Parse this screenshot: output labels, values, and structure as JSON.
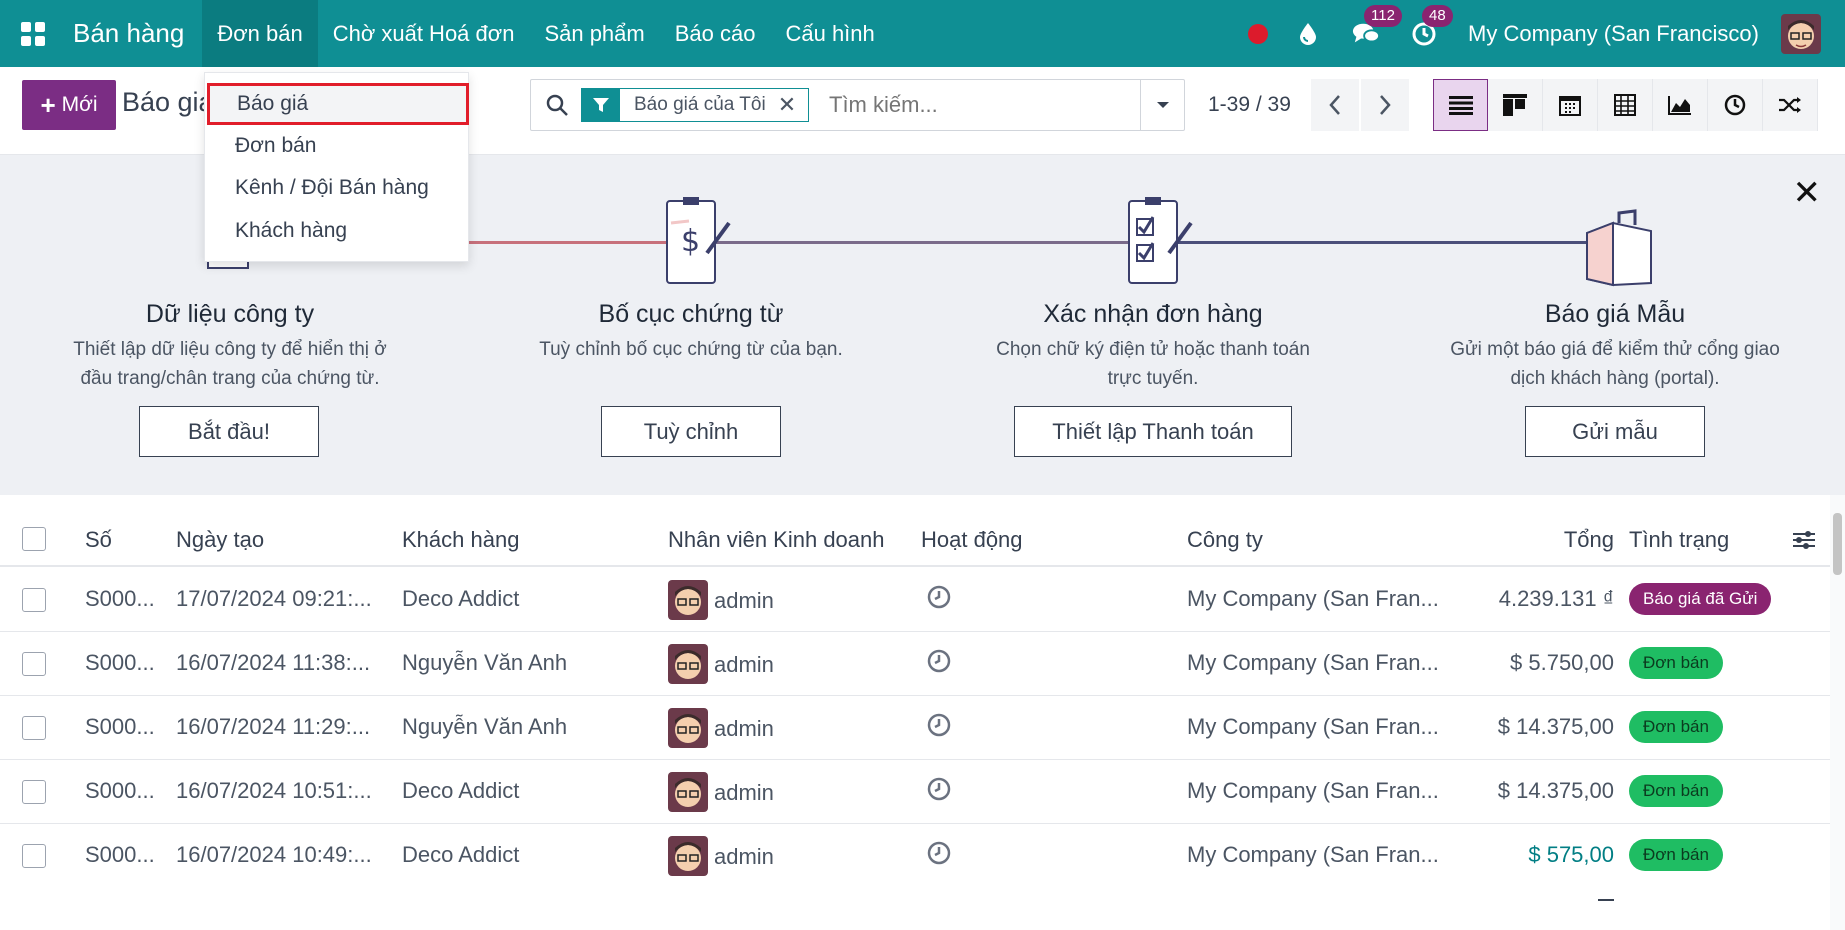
{
  "navbar": {
    "brand": "Bán hàng",
    "menus": [
      "Đơn bán",
      "Chờ xuất Hoá đơn",
      "Sản phẩm",
      "Báo cáo",
      "Cấu hình"
    ],
    "messages_count": "112",
    "activities_count": "48",
    "company": "My Company (San Francisco)"
  },
  "dropdown": {
    "items": [
      "Báo giá",
      "Đơn bán",
      "Kênh / Đội Bán hàng",
      "Khách hàng"
    ]
  },
  "control": {
    "new_label": "Mới",
    "breadcrumb": "Báo giá",
    "facet_label": "Báo giá của Tôi",
    "search_placeholder": "Tìm kiếm...",
    "pager": "1-39 / 39"
  },
  "onboarding": {
    "steps": [
      {
        "title": "Dữ liệu công ty",
        "desc": "Thiết lập dữ liệu công ty để hiển thị ở đầu trang/chân trang của chứng từ.",
        "button": "Bắt đầu!"
      },
      {
        "title": "Bố cục chứng từ",
        "desc": "Tuỳ chỉnh bố cục chứng từ của bạn.",
        "button": "Tuỳ chỉnh"
      },
      {
        "title": "Xác nhận đơn hàng",
        "desc": "Chọn chữ ký điện tử hoặc thanh toán trực tuyến.",
        "button": "Thiết lập Thanh toán"
      },
      {
        "title": "Báo giá Mẫu",
        "desc": "Gửi một báo giá để kiểm thử cổng giao dịch khách hàng (portal).",
        "button": "Gửi mẫu"
      }
    ]
  },
  "table": {
    "columns": [
      "Số",
      "Ngày tạo",
      "Khách hàng",
      "Nhân viên Kinh doanh",
      "Hoạt động",
      "Công ty",
      "Tổng",
      "Tình trạng"
    ],
    "rows": [
      {
        "number": "S000...",
        "date": "17/07/2024 09:21:...",
        "customer": "Deco Addict",
        "salesperson": "admin",
        "company": "My Company (San Fran...",
        "total": "4.239.131 ₫",
        "status": "Báo giá đã Gửi"
      },
      {
        "number": "S000...",
        "date": "16/07/2024 11:38:...",
        "customer": "Nguyễn Văn Anh",
        "salesperson": "admin",
        "company": "My Company (San Fran...",
        "total": "$ 5.750,00",
        "status": "Đơn bán"
      },
      {
        "number": "S000...",
        "date": "16/07/2024 11:29:...",
        "customer": "Nguyễn Văn Anh",
        "salesperson": "admin",
        "company": "My Company (San Fran...",
        "total": "$ 14.375,00",
        "status": "Đơn bán"
      },
      {
        "number": "S000...",
        "date": "16/07/2024 10:51:...",
        "customer": "Deco Addict",
        "salesperson": "admin",
        "company": "My Company (San Fran...",
        "total": "$ 14.375,00",
        "status": "Đơn bán"
      },
      {
        "number": "S000...",
        "date": "16/07/2024 10:49:...",
        "customer": "Deco Addict",
        "salesperson": "admin",
        "company": "My Company (San Fran...",
        "total": "$ 575,00",
        "status": "Đơn bán"
      }
    ]
  },
  "colors": {
    "navbar": "#0f8f94",
    "primary": "#7b2d84",
    "sent_badge": "#8a2470",
    "sale_badge": "#1fbd63",
    "highlight_border": "#e11d2a"
  }
}
